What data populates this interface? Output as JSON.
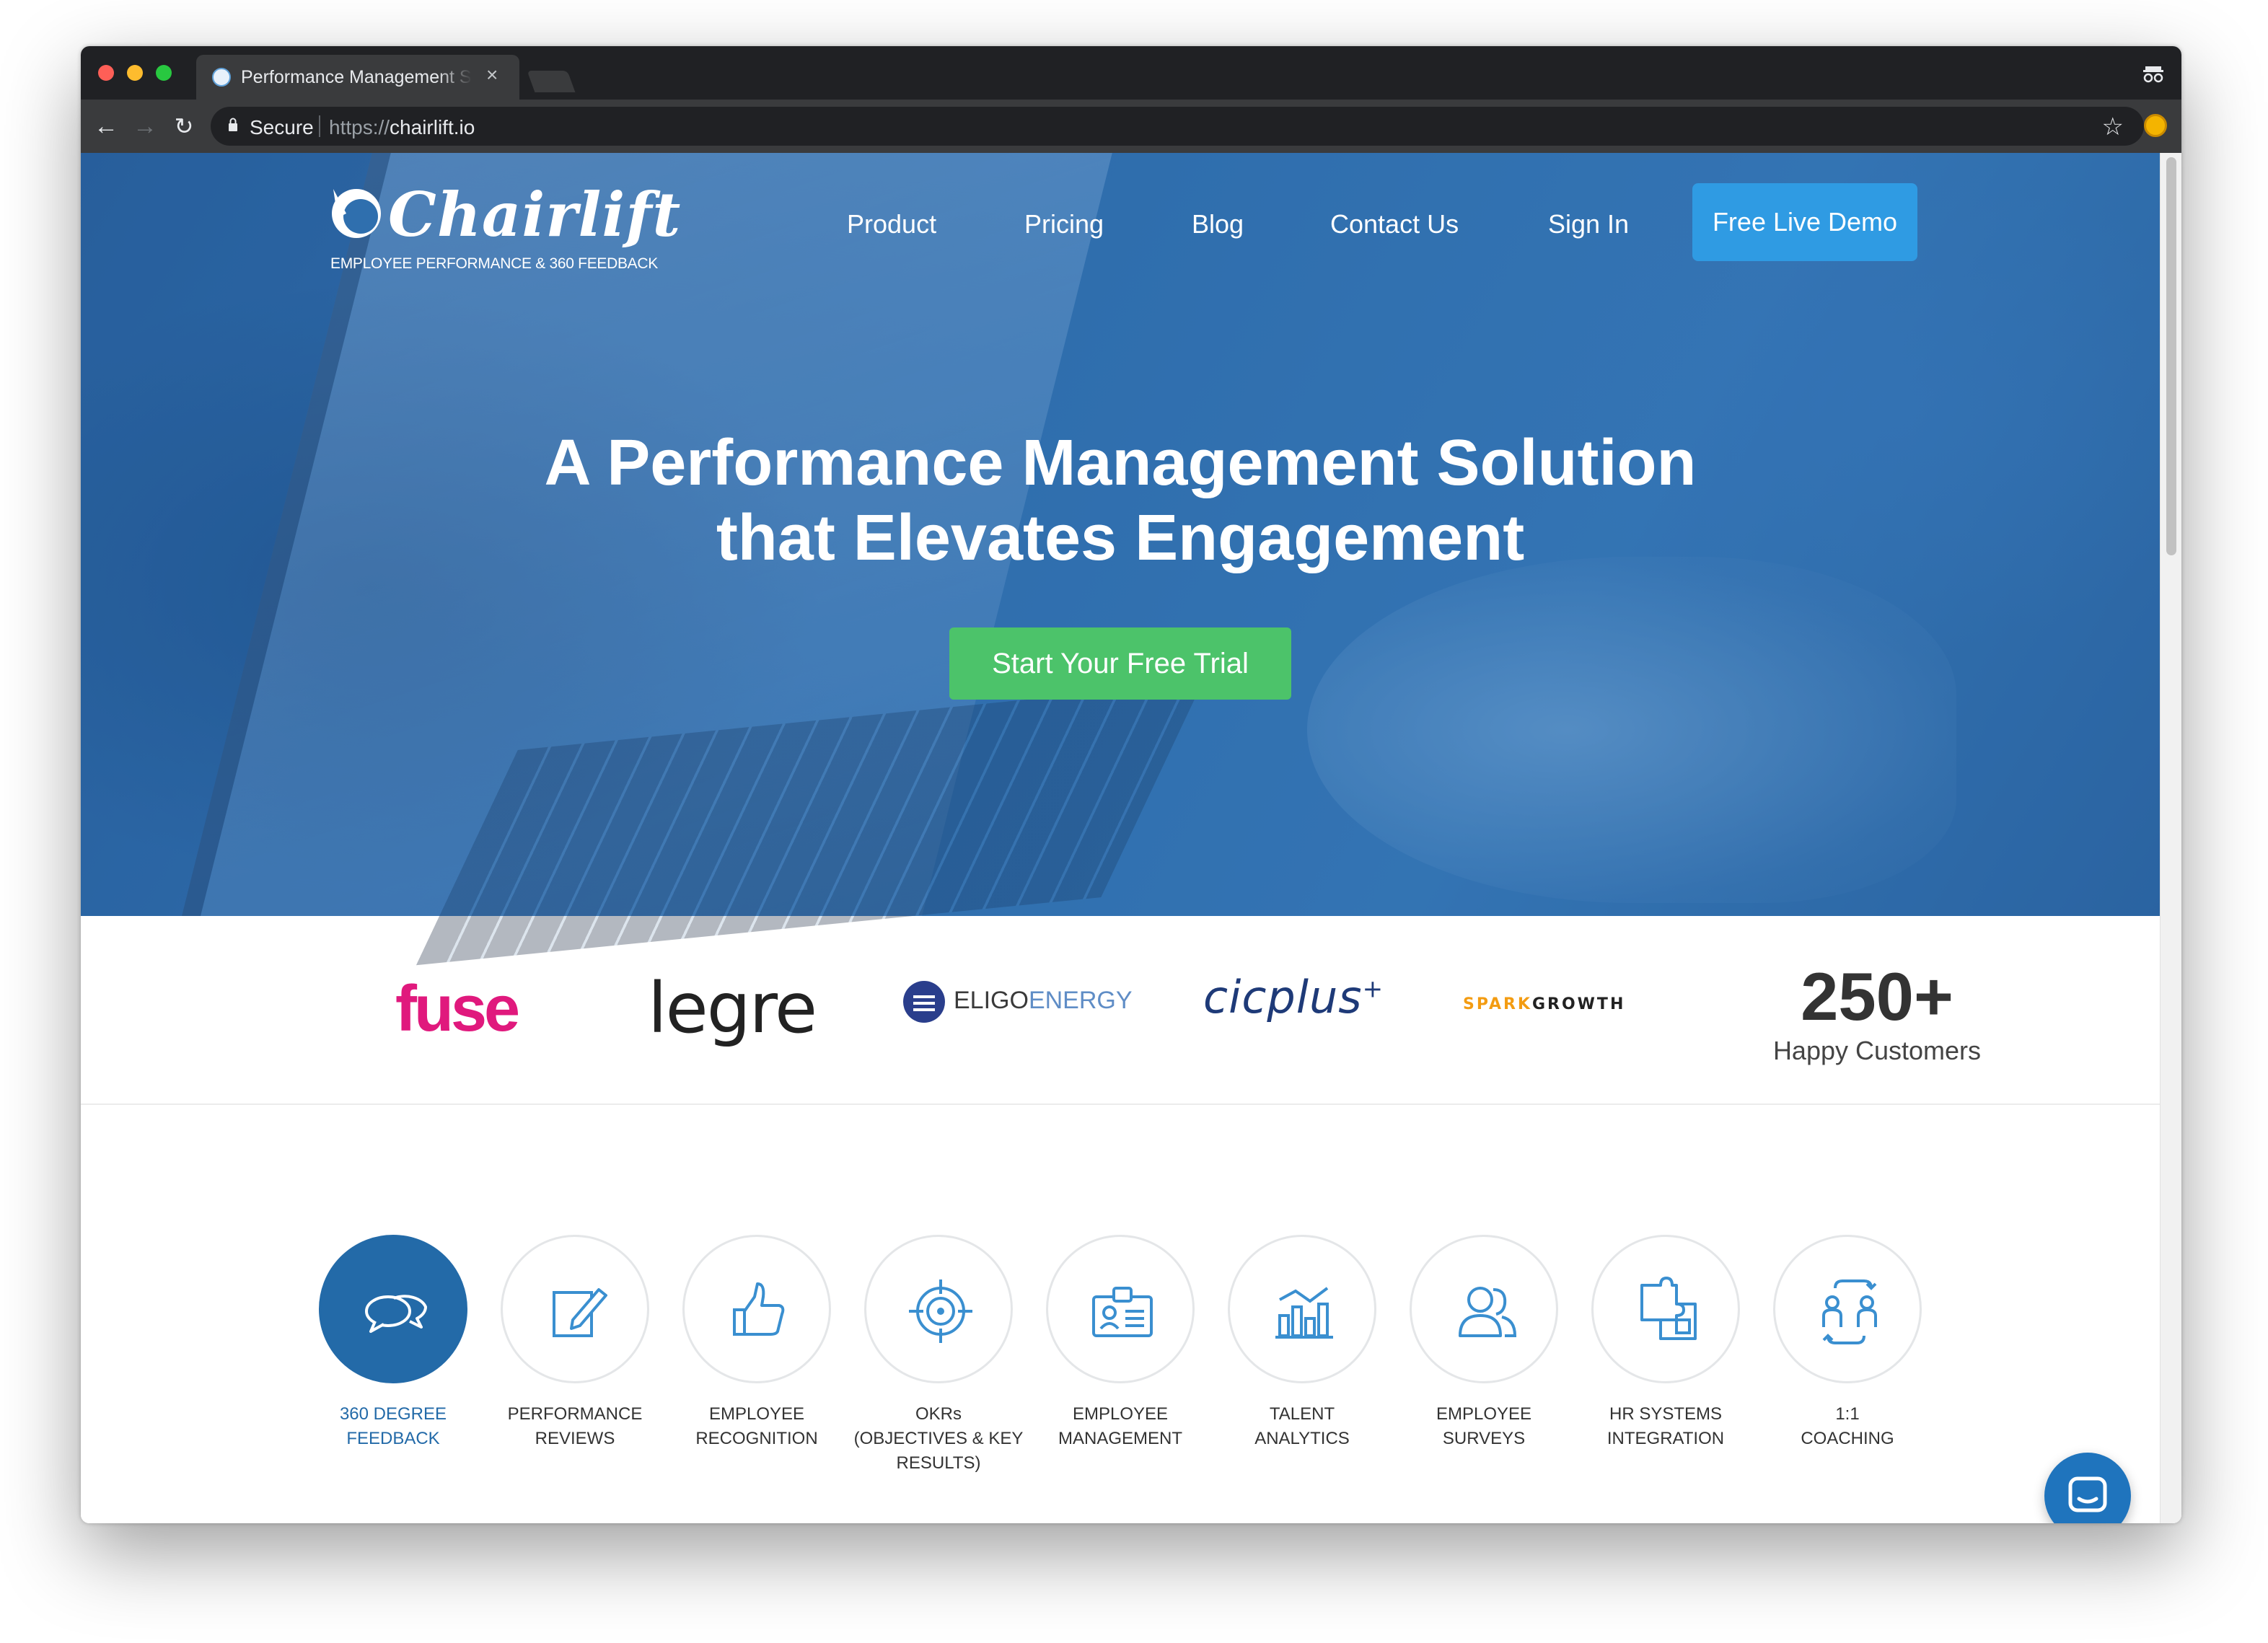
{
  "browser": {
    "tab_title": "Performance Management Sof",
    "tab_close": "×",
    "secure_label": "Secure",
    "url_scheme": "https://",
    "url_host": "chairlift.io"
  },
  "header": {
    "logo_text": "Chairlift",
    "tagline": "EMPLOYEE PERFORMANCE & 360 FEEDBACK",
    "nav": [
      "Product",
      "Pricing",
      "Blog",
      "Contact Us",
      "Sign In"
    ],
    "cta": "Free Live Demo"
  },
  "hero": {
    "title_line1": "A Performance Management Solution",
    "title_line2": "that Elevates Engagement",
    "cta": "Start Your Free Trial"
  },
  "customers": {
    "logos": {
      "fuse": "fuse",
      "legre": "legre",
      "eligo_a": "ELIGO",
      "eligo_b": "ENERGY",
      "cic": "cicplus",
      "cic_sup": "+",
      "spark_a": "SPARK",
      "spark_b": "GROWTH"
    },
    "count": "250+",
    "count_label": "Happy Customers"
  },
  "features": [
    {
      "line1": "360 DEGREE",
      "line2": "FEEDBACK",
      "line3": "",
      "icon": "speech-bubbles-icon",
      "active": true
    },
    {
      "line1": "PERFORMANCE",
      "line2": "REVIEWS",
      "line3": "",
      "icon": "edit-document-icon"
    },
    {
      "line1": "EMPLOYEE",
      "line2": "RECOGNITION",
      "line3": "",
      "icon": "thumbs-up-icon"
    },
    {
      "line1": "OKRs",
      "line2": "(OBJECTIVES & KEY",
      "line3": "RESULTS)",
      "icon": "target-icon"
    },
    {
      "line1": "EMPLOYEE",
      "line2": "MANAGEMENT",
      "line3": "",
      "icon": "id-card-icon"
    },
    {
      "line1": "TALENT",
      "line2": "ANALYTICS",
      "line3": "",
      "icon": "bar-chart-icon"
    },
    {
      "line1": "EMPLOYEE",
      "line2": "SURVEYS",
      "line3": "",
      "icon": "people-icon"
    },
    {
      "line1": "HR SYSTEMS",
      "line2": "INTEGRATION",
      "line3": "",
      "icon": "puzzle-icon"
    },
    {
      "line1": "1:1",
      "line2": "COACHING",
      "line3": "",
      "icon": "coaching-icon"
    }
  ],
  "colors": {
    "brand_blue": "#236aa8",
    "demo_button": "#2f9be3",
    "trial_button": "#4cc36a",
    "fuse_pink": "#e0197d"
  }
}
